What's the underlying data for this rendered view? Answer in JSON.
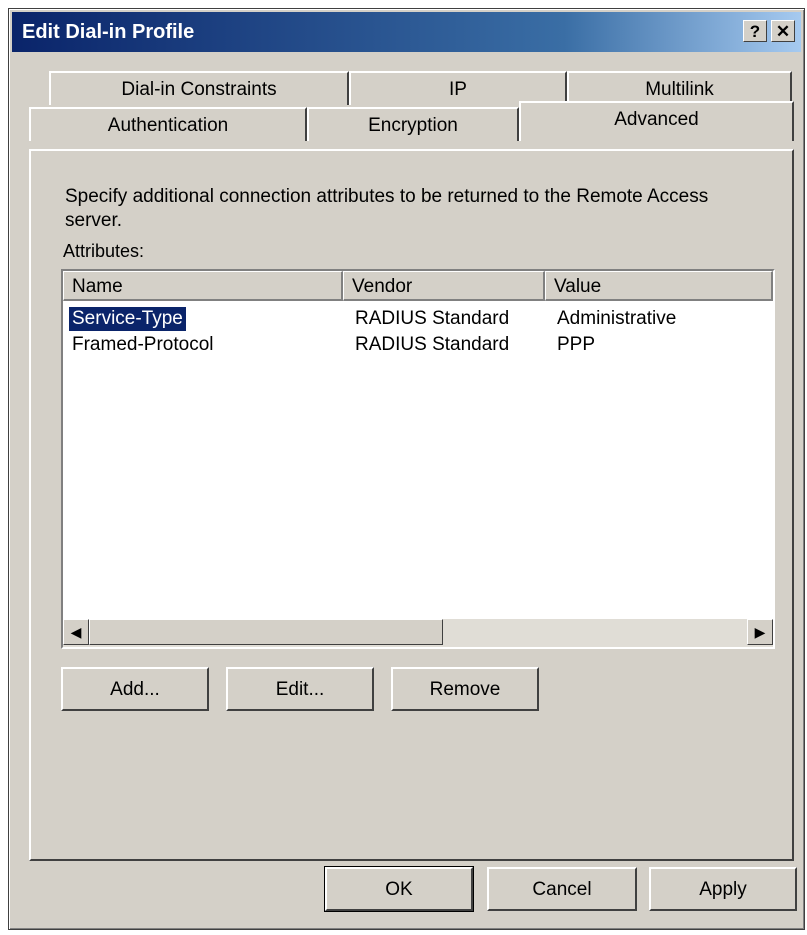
{
  "window": {
    "title": "Edit Dial-in Profile",
    "help_glyph": "?",
    "close_glyph": "✕"
  },
  "tabs": {
    "row1": [
      "Dial-in Constraints",
      "IP",
      "Multilink"
    ],
    "row2": [
      "Authentication",
      "Encryption",
      "Advanced"
    ],
    "active": "Advanced"
  },
  "advanced": {
    "description": "Specify additional connection attributes to be returned to the Remote Access server.",
    "attributes_label": "Attributes:",
    "columns": [
      "Name",
      "Vendor",
      "Value"
    ],
    "rows": [
      {
        "name": "Service-Type",
        "vendor": "RADIUS Standard",
        "value": "Administrative",
        "selected": true
      },
      {
        "name": "Framed-Protocol",
        "vendor": "RADIUS Standard",
        "value": "PPP",
        "selected": false
      }
    ],
    "buttons": {
      "add": "Add...",
      "edit": "Edit...",
      "remove": "Remove"
    }
  },
  "footer": {
    "ok": "OK",
    "cancel": "Cancel",
    "apply": "Apply"
  },
  "colors": {
    "titlebar": "#0a246a",
    "face": "#d4d0c8",
    "selection": "#0a246a"
  }
}
